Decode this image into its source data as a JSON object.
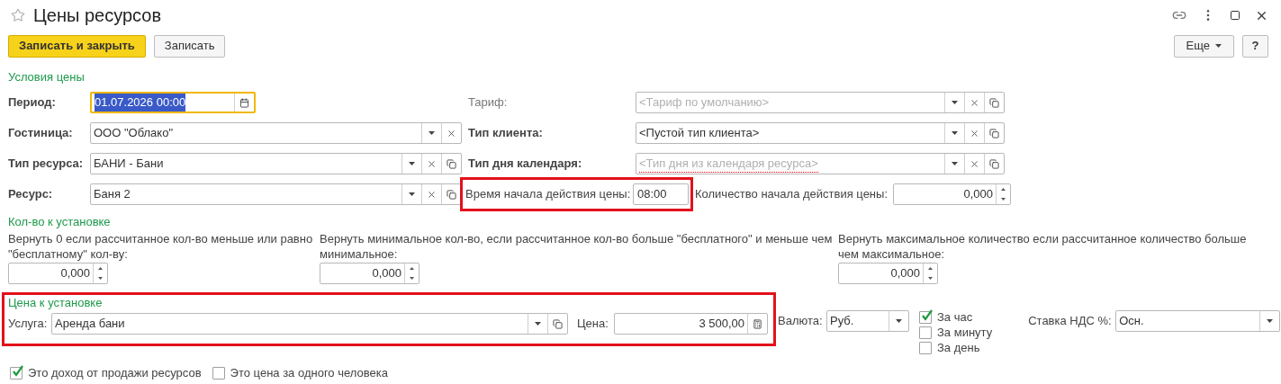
{
  "window": {
    "title": "Цены ресурсов",
    "favorite": false
  },
  "toolbar": {
    "buttons": [
      {
        "label": "Записать и закрыть",
        "kind": "primary"
      },
      {
        "label": "Записать",
        "kind": "default"
      }
    ],
    "more": "Еще",
    "help": "?"
  },
  "price_conditions": {
    "title": "Условия цены",
    "left": [
      {
        "label": "Период:",
        "bold": true,
        "value": "01.07.2026 00:00",
        "kind": "date",
        "focused": true,
        "text_selected": true,
        "buttons": [
          {
            "kind": "calendar"
          }
        ]
      },
      {
        "label": "Гостиница:",
        "bold": true,
        "value": "ООО \"Облако\"",
        "kind": "select",
        "buttons": [
          {
            "kind": "dropdown"
          },
          {
            "kind": "clear"
          }
        ]
      },
      {
        "label": "Тип ресурса:",
        "bold": true,
        "value": "БАНИ - Бани",
        "kind": "select",
        "buttons": [
          {
            "kind": "dropdown"
          },
          {
            "kind": "clear"
          },
          {
            "kind": "open"
          }
        ]
      },
      {
        "label": "Ресурс:",
        "bold": true,
        "value": "Баня 2",
        "kind": "select",
        "buttons": [
          {
            "kind": "dropdown"
          },
          {
            "kind": "clear"
          },
          {
            "kind": "open"
          }
        ]
      }
    ],
    "right": [
      {
        "label": "Тариф:",
        "bold": false,
        "placeholder": "<Тариф по умолчанию>",
        "buttons": [
          {
            "kind": "dropdown"
          },
          {
            "kind": "clear"
          },
          {
            "kind": "open"
          }
        ]
      },
      {
        "label": "Тип клиента:",
        "bold": true,
        "value": "<Пустой тип клиента>",
        "buttons": [
          {
            "kind": "dropdown"
          },
          {
            "kind": "clear"
          },
          {
            "kind": "open"
          }
        ]
      },
      {
        "label": "Тип дня календаря:",
        "bold": true,
        "placeholder": "<Тип дня из календаря ресурса>",
        "invalid": true,
        "buttons": [
          {
            "kind": "dropdown"
          },
          {
            "kind": "clear"
          },
          {
            "kind": "open"
          }
        ]
      }
    ],
    "start_time": {
      "label": "Время начала действия цены:",
      "value": "08:00",
      "highlighted": true
    },
    "start_quantity": {
      "label": "Количество начала действия цены:",
      "value": "0,000"
    }
  },
  "quantity": {
    "title": "Кол-во к установке",
    "fields": [
      {
        "label": "Вернуть 0 если рассчитанное кол-во меньше или равно \"бесплатному\" кол-ву:",
        "value": "0,000"
      },
      {
        "label": "Вернуть минимальное кол-во, если рассчитанное кол-во больше \"бесплатного\" и меньше чем минимальное:",
        "value": "0,000"
      },
      {
        "label": "Вернуть максимальное количество если рассчитанное количество больше чем максимальное:",
        "value": "0,000"
      }
    ]
  },
  "price": {
    "title": "Цена к установке",
    "highlighted": true,
    "service": {
      "label": "Услуга:",
      "value": "Аренда бани"
    },
    "amount": {
      "label": "Цена:",
      "value": "3 500,00"
    },
    "currency": {
      "label": "Валюта:",
      "value": "Руб."
    },
    "periods": [
      {
        "label": "За час",
        "checked": true
      },
      {
        "label": "За минуту",
        "checked": false
      },
      {
        "label": "За день",
        "checked": false
      }
    ],
    "vat": {
      "label": "Ставка НДС %:",
      "value": "Осн."
    }
  },
  "options": [
    {
      "label": "Это доход от продажи ресурсов",
      "checked": true
    },
    {
      "label": "Это цена за одного человека",
      "checked": false
    }
  ]
}
